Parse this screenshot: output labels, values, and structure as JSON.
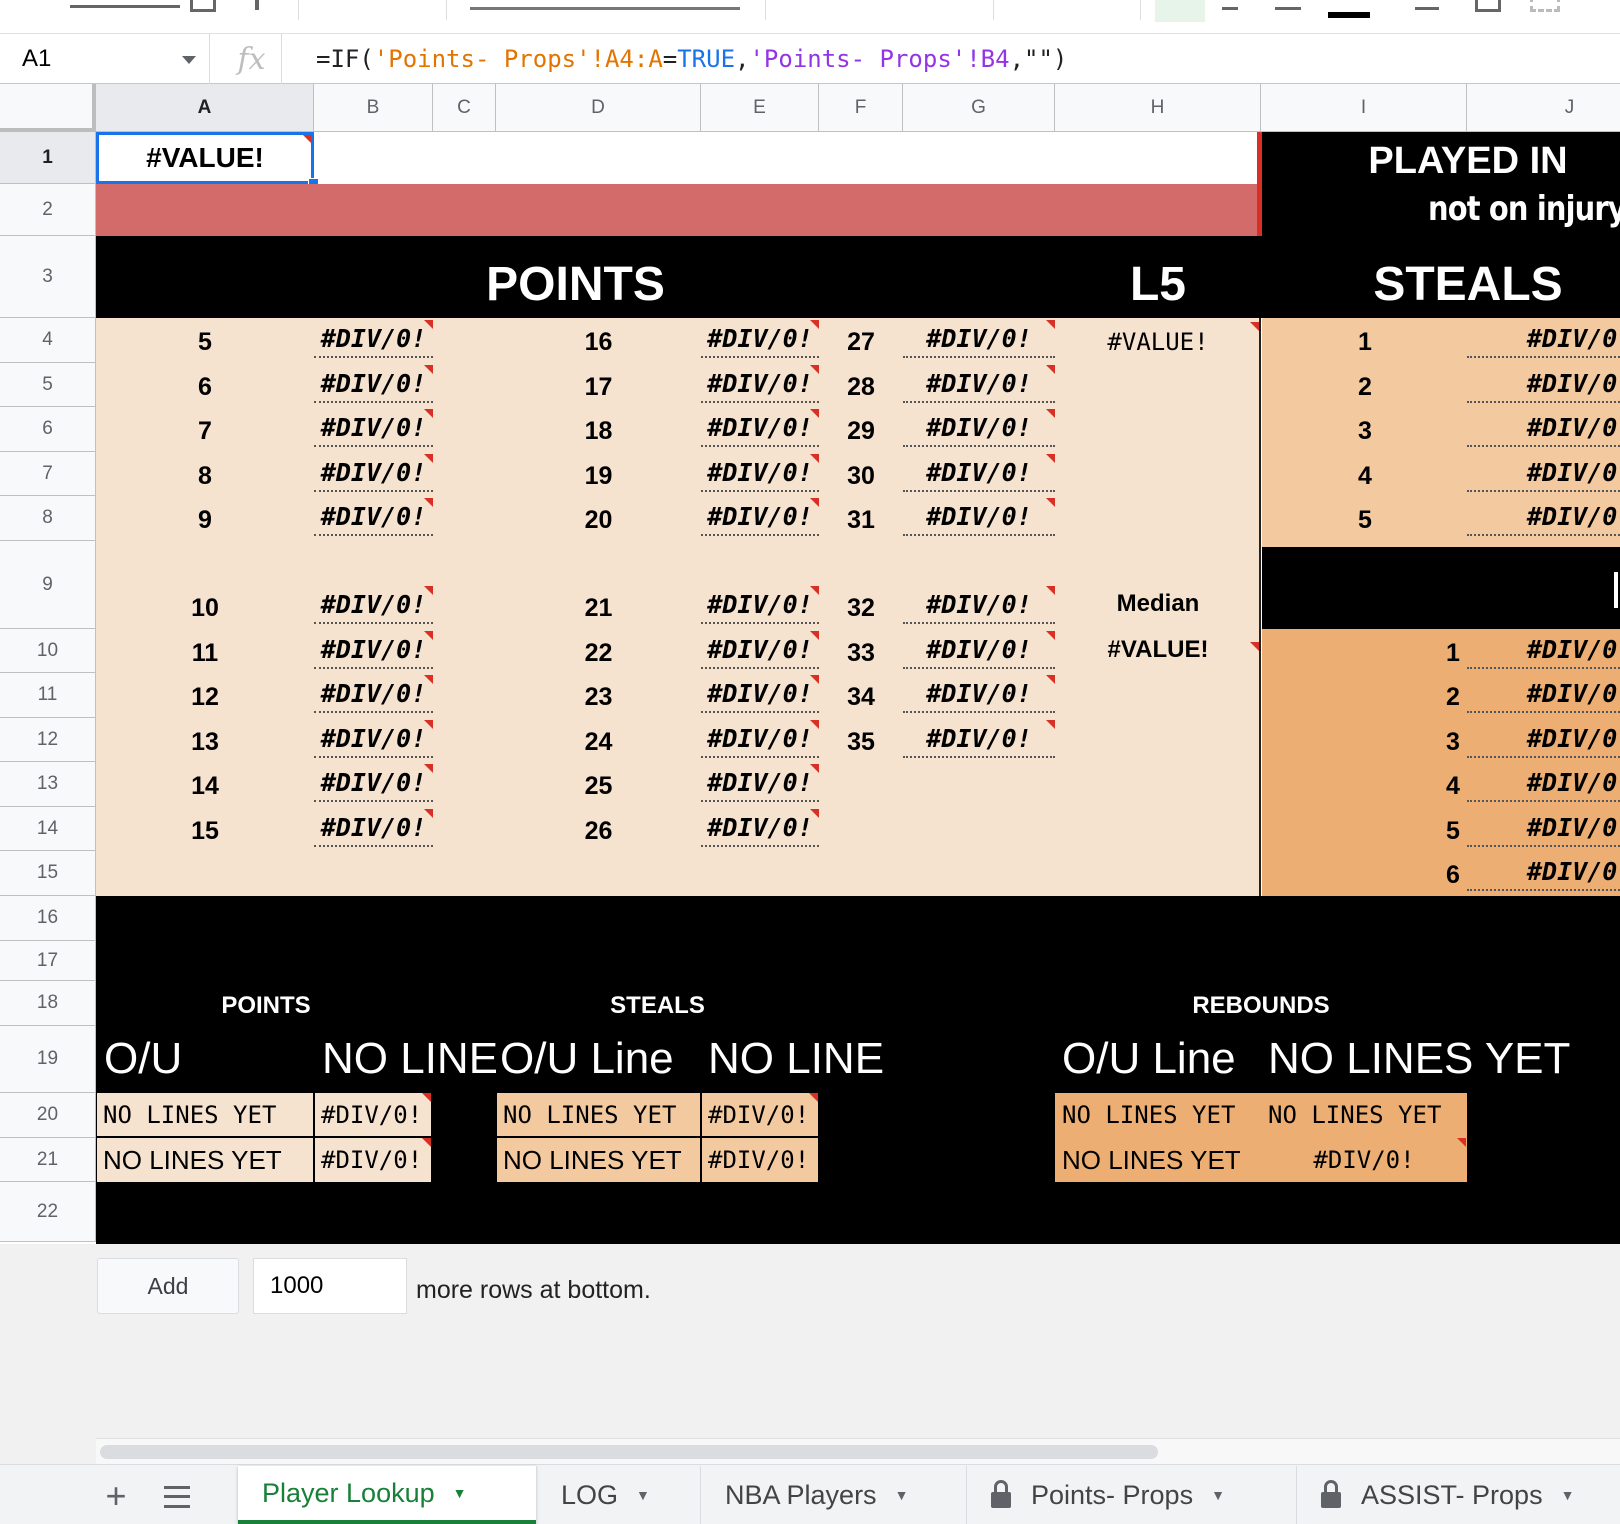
{
  "formula_bar": {
    "name_box": "A1",
    "fx_icon": "fx",
    "formula_segments": [
      {
        "text": "=IF(",
        "color": "#202124"
      },
      {
        "text": "'Points- Props'!A4:A",
        "color": "#e37400"
      },
      {
        "text": "=",
        "color": "#202124"
      },
      {
        "text": "TRUE",
        "color": "#1a73e8"
      },
      {
        "text": ",",
        "color": "#202124"
      },
      {
        "text": "'Points- Props'!B4",
        "color": "#9334e6"
      },
      {
        "text": ",\"\")",
        "color": "#202124"
      }
    ]
  },
  "columns": [
    "A",
    "B",
    "C",
    "D",
    "E",
    "F",
    "G",
    "H",
    "I",
    "J"
  ],
  "rows": [
    "1",
    "2",
    "3",
    "4",
    "5",
    "6",
    "7",
    "8",
    "9",
    "10",
    "11",
    "12",
    "13",
    "14",
    "15",
    "16",
    "17",
    "18",
    "19",
    "20",
    "21",
    "22"
  ],
  "sheet": {
    "a1_value": "#VALUE!",
    "played_in_title": "PLAYED IN",
    "played_in_subtitle": "not on injury",
    "points_title": "POINTS",
    "l5_title": "L5",
    "steals_title": "STEALS",
    "points_col1_nums": [
      "5",
      "6",
      "7",
      "8",
      "9",
      "10",
      "11",
      "12",
      "13",
      "14",
      "15"
    ],
    "points_col2_nums": [
      "16",
      "17",
      "18",
      "19",
      "20",
      "21",
      "22",
      "23",
      "24",
      "25",
      "26"
    ],
    "points_col3_nums": [
      "27",
      "28",
      "29",
      "30",
      "31",
      "32",
      "33",
      "34",
      "35"
    ],
    "div_error": "#DIV/0!",
    "l5_value": "#VALUE!",
    "median_label": "Median",
    "median_value": "#VALUE!",
    "steals_top_nums": [
      "1",
      "2",
      "3",
      "4",
      "5"
    ],
    "steals_bottom_nums": [
      "1",
      "2",
      "3",
      "4",
      "5",
      "6"
    ],
    "bottom": {
      "points_label": "POINTS",
      "steals_label": "STEALS",
      "rebounds_label": "REBOUNDS",
      "points_ou": "O/U",
      "points_noline": "NO LINE",
      "steals_ou": "O/U Line",
      "steals_noline": "NO LINE",
      "rebounds_ou": "O/U Line",
      "rebounds_noline": "NO LINES YET",
      "no_lines_yet": "NO LINES YET",
      "div_error": "#DIV/0!"
    }
  },
  "add_rows": {
    "button_label": "Add",
    "count_value": "1000",
    "suffix": "more rows at bottom."
  },
  "tabs": [
    {
      "label": "Player Lookup",
      "active": true,
      "locked": false
    },
    {
      "label": "LOG",
      "active": false,
      "locked": false
    },
    {
      "label": "NBA Players",
      "active": false,
      "locked": false
    },
    {
      "label": "Points- Props",
      "active": false,
      "locked": true
    },
    {
      "label": "ASSIST- Props",
      "active": false,
      "locked": true
    }
  ],
  "colors": {
    "peach_light": "#f5e2cf",
    "peach": "#f3c99f",
    "orange": "#ecae72",
    "red_band": "#d46b6b",
    "black": "#000000",
    "active_green": "#188038"
  }
}
